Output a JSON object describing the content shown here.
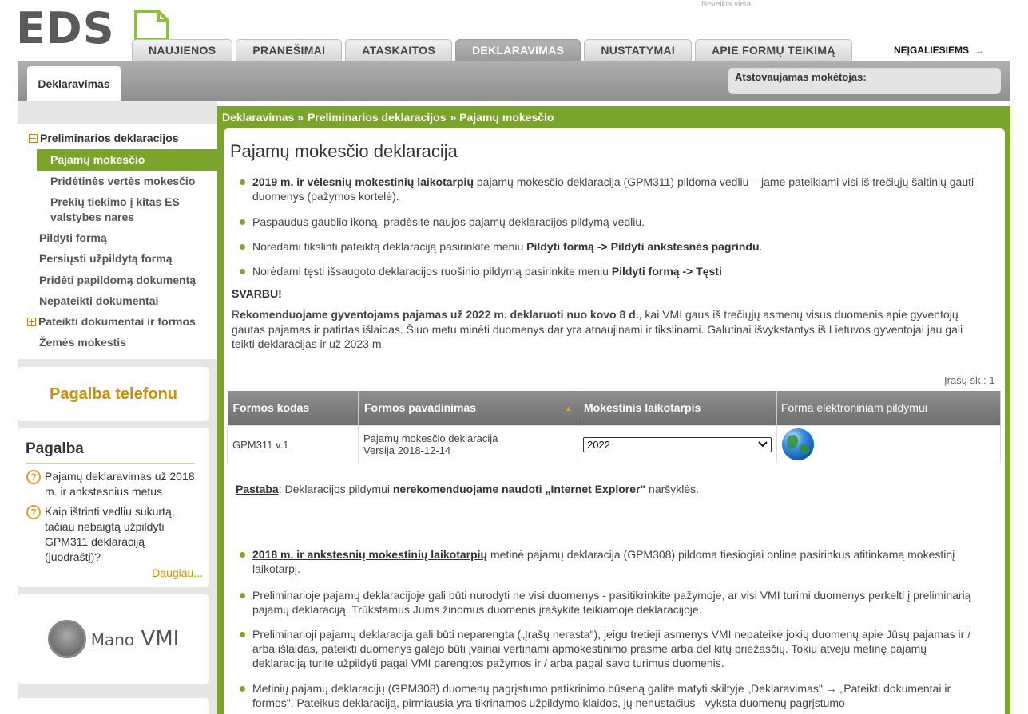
{
  "header": {
    "logo_text": "EDS",
    "top_note": "Neveikia vieta",
    "tabs": [
      "NAUJIENOS",
      "PRANEŠIMAI",
      "ATASKAITOS",
      "DEKLARAVIMAS",
      "NUSTATYMAI",
      "APIE FORMŲ TEIKIMĄ"
    ],
    "active_tab": "DEKLARAVIMAS",
    "accessibility_link": "NEĮGALIESIEMS",
    "subtab": "Deklaravimas",
    "represented_label": "Atstovaujamas mokėtojas:"
  },
  "sidebar": {
    "items": [
      {
        "label": "Preliminarios deklaracijos",
        "type": "parent-expanded"
      },
      {
        "label": "Pajamų mokesčio",
        "type": "selected"
      },
      {
        "label": "Pridėtinės vertės mokesčio",
        "type": "child"
      },
      {
        "label": "Prekių tiekimo į kitas ES valstybes nares",
        "type": "child"
      },
      {
        "label": "Pildyti formą",
        "type": "item"
      },
      {
        "label": "Persiųsti užpildytą formą",
        "type": "item"
      },
      {
        "label": "Pridėti papildomą dokumentą",
        "type": "item"
      },
      {
        "label": "Nepateikti dokumentai",
        "type": "item"
      },
      {
        "label": "Pateikti dokumentai ir formos",
        "type": "parent-collapsed"
      },
      {
        "label": "Žemės mokestis",
        "type": "item"
      }
    ],
    "phone_help": "Pagalba telefonu",
    "help_title": "Pagalba",
    "help_items": [
      "Pajamų deklaravimas už 2018 m. ir ankstesnius metus",
      "Kaip ištrinti vedliu sukurtą, tačiau nebaigtą užpildyti GPM311 deklaraciją (juodraštį)?"
    ],
    "more_link": "Daugiau...",
    "mano_vmi": {
      "prefix": "Mano",
      "suffix": "VMI"
    }
  },
  "breadcrumb": [
    "Deklaravimas »",
    "Preliminarios deklaracijos",
    "» Pajamų mokesčio"
  ],
  "main": {
    "title": "Pajamų mokesčio deklaracija",
    "bullets_top": [
      {
        "link": "2019 m. ir vėlesnių mokestinių laikotarpių",
        "text": " pajamų mokesčio deklaracija (GPM311) pildoma vedliu – jame pateikiami visi iš trečiųjų šaltinių gauti duomenys (pažymos kortelė)."
      },
      {
        "text": "Paspaudus gaublio ikoną, pradėsite naujos pajamų deklaracijos pildymą vedliu."
      },
      {
        "text": "Norėdami tikslinti pateiktą deklaraciją pasirinkite meniu ",
        "bold": "Pildyti formą -> Pildyti ankstesnės pagrindu",
        "tail": "."
      },
      {
        "text": "Norėdami tęsti išsaugoto deklaracijos ruošinio pildymą pasirinkite meniu ",
        "bold": "Pildyti formą -> Tęsti",
        "tail": ""
      }
    ],
    "important_label": "SVARBU!",
    "important_text": {
      "first": "R",
      "bold": "ekomenduojame gyventojams pajamas už 2022 m. deklaruoti nuo kovo 8 d.",
      "rest": ", kai VMI gaus iš trečiųjų asmenų visus duomenis apie gyventojų gautas pajamas ir patirtas išlaidas. Šiuo metu minėti duomenys dar yra atnaujinami ir tikslinami. Galutinai išvykstantys iš Lietuvos gyventojai jau gali teikti deklaracijas ir už 2023 m."
    },
    "records_count": "Įrašų sk.: 1",
    "table": {
      "headers": [
        "Formos kodas",
        "Formos pavadinimas",
        "Mokestinis laikotarpis",
        "Forma elektroniniam pildymui"
      ],
      "rows": [
        {
          "code": "GPM311 v.1",
          "name": "Pajamų mokesčio deklaracija",
          "version": "Versija 2018-12-14",
          "period": "2022",
          "icon": "globe-icon"
        }
      ]
    },
    "note": {
      "label": "Pastaba",
      "text": ": Deklaracijos pildymui ",
      "bold": "nerekomenduojame naudoti „Internet Explorer\"",
      "tail": " naršyklės."
    },
    "bullets_bottom": [
      {
        "link": "2018 m. ir ankstesnių mokestinių laikotarpių",
        "text": " metinė pajamų deklaracija (GPM308) pildoma tiesiogiai online pasirinkus atitinkamą mokestinį laikotarpį."
      },
      {
        "text": "Preliminarioje pajamų deklaracijoje gali būti nurodyti ne visi duomenys - pasitikrinkite pažymoje, ar visi VMI turimi duomenys perkelti į preliminarią pajamų deklaraciją. Trūkstamus Jums žinomus duomenis įrašykite teikiamoje deklaracijoje."
      },
      {
        "text": "Preliminarioji pajamų deklaracija gali būti neparengta („Įrašų nerasta\"), jeigu tretieji asmenys VMI nepateikė jokių duomenų apie Jūsų pajamas ir / arba išlaidas, pateikti duomenys galėjo būti įvairiai vertinami apmokestinimo prasme arba dėl kitų priežasčių. Tokiu atveju metinę pajamų deklaraciją turite užpildyti pagal VMI parengtos pažymos ir / arba pagal savo turimus duomenis."
      },
      {
        "text": "Metinių pajamų deklaracijų (GPM308) duomenų pagrįstumo patikrinimo būseną galite matyti skiltyje „Deklaravimas\" → „Pateikti dokumentai ir formos\". Pateikus deklaraciją, pirmiausia yra tikrinamos užpildymo klaidos, jų nenustačius - vyksta duomenų pagrįstumo"
      }
    ]
  }
}
